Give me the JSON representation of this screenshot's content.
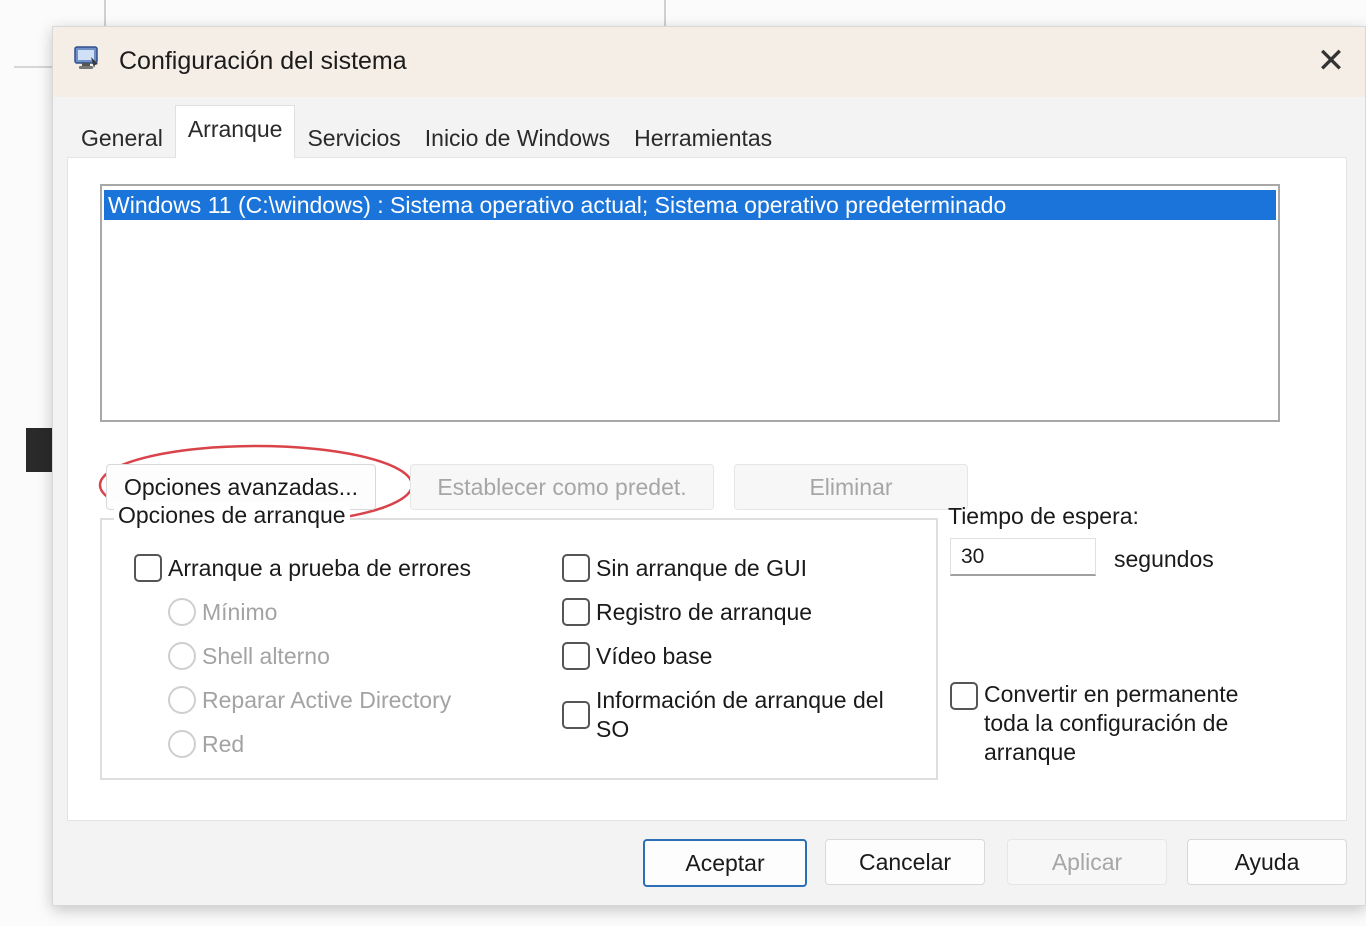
{
  "window": {
    "title": "Configuración del sistema",
    "close_glyph": "✕"
  },
  "tabs": [
    {
      "label": "General",
      "active": false
    },
    {
      "label": "Arranque",
      "active": true
    },
    {
      "label": "Servicios",
      "active": false
    },
    {
      "label": "Inicio de Windows",
      "active": false
    },
    {
      "label": "Herramientas",
      "active": false
    }
  ],
  "os_list": {
    "items": [
      "Windows 11 (C:\\windows) : Sistema operativo actual; Sistema operativo predeterminado"
    ],
    "selected_index": 0
  },
  "buttons": {
    "advanced": "Opciones avanzadas...",
    "set_default": "Establecer como predet.",
    "delete": "Eliminar",
    "ok": "Aceptar",
    "cancel": "Cancelar",
    "apply": "Aplicar",
    "help": "Ayuda"
  },
  "boot_options": {
    "title": "Opciones de arranque",
    "safe_boot": {
      "label": "Arranque a prueba de errores",
      "checked": false
    },
    "safe_boot_modes": [
      {
        "label": "Mínimo",
        "enabled": false
      },
      {
        "label": "Shell alterno",
        "enabled": false
      },
      {
        "label": "Reparar Active Directory",
        "enabled": false
      },
      {
        "label": "Red",
        "enabled": false
      }
    ],
    "no_gui_boot": {
      "label": "Sin arranque de GUI",
      "checked": false
    },
    "boot_log": {
      "label": "Registro de arranque",
      "checked": false
    },
    "base_video": {
      "label": "Vídeo base",
      "checked": false
    },
    "os_boot_info": {
      "label": "Información de arranque del SO",
      "checked": false
    }
  },
  "timeout": {
    "label": "Tiempo de espera:",
    "value": "30",
    "unit": "segundos"
  },
  "make_permanent": {
    "label": "Convertir en permanente toda la configuración de arranque",
    "checked": false
  },
  "colors": {
    "selection": "#1a74d9",
    "highlight_annotation": "#d9434a",
    "titlebar": "#f5eee6"
  }
}
